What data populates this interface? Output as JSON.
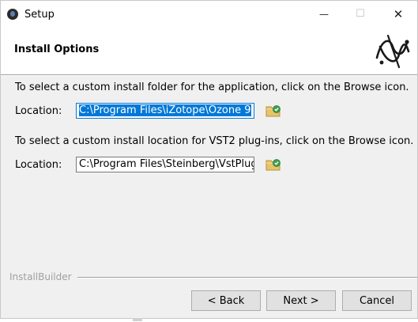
{
  "window": {
    "title": "Setup",
    "minimize_glyph": "—",
    "maximize_glyph": "☐",
    "close_glyph": "✕"
  },
  "header": {
    "title": "Install Options",
    "logo_icon": "izotope-logo-icon"
  },
  "app_folder": {
    "description": "To select a custom install folder for the application, click on the Browse icon.",
    "label": "Location:",
    "value": "C:\\Program Files\\iZotope\\Ozone 9",
    "browse_icon": "folder-browse-icon"
  },
  "vst2_folder": {
    "description": "To select a custom install location for VST2 plug-ins, click on the Browse icon.",
    "label": "Location:",
    "value": "C:\\Program Files\\Steinberg\\VstPlugins",
    "browse_icon": "folder-browse-icon"
  },
  "footer": {
    "brand": "InstallBuilder",
    "back_label": "< Back",
    "next_label": "Next >",
    "cancel_label": "Cancel"
  },
  "colors": {
    "selection": "#0078d7",
    "dialog_bg": "#f0f0f0",
    "button_bg": "#e1e1e1"
  }
}
